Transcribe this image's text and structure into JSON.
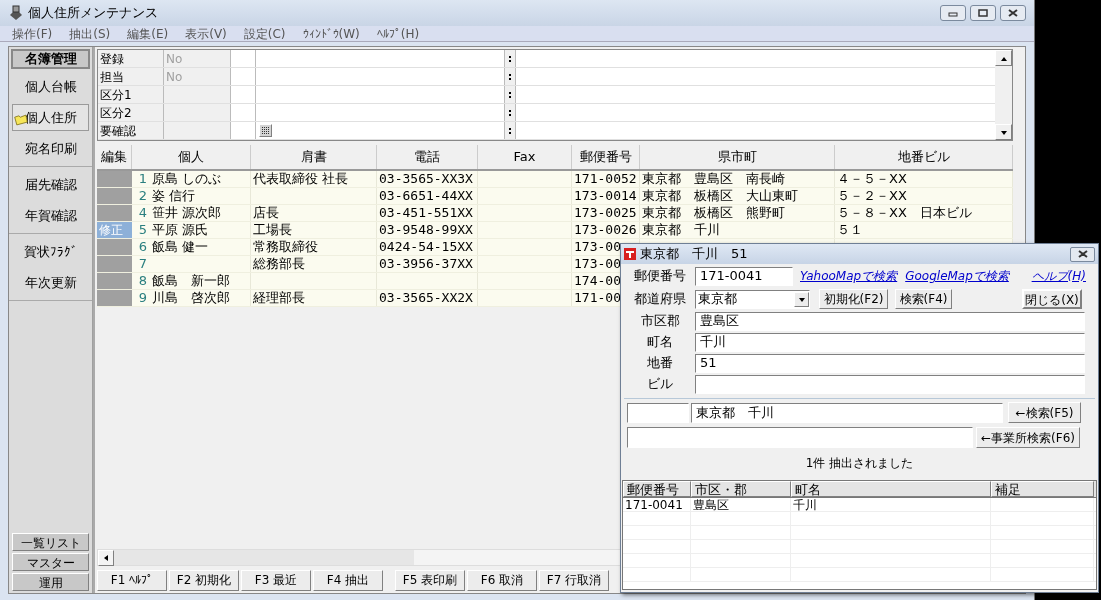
{
  "window": {
    "title": "個人住所メンテナンス"
  },
  "menu": [
    "操作(F)",
    "抽出(S)",
    "編集(E)",
    "表示(V)",
    "設定(C)",
    "ｳｨﾝﾄﾞｳ(W)",
    "ﾍﾙﾌﾟ(H)"
  ],
  "sidebar": {
    "header": "名簿管理",
    "groups": [
      [
        {
          "label": "個人台帳",
          "selected": false
        },
        {
          "label": "個人住所",
          "selected": true
        },
        {
          "label": "宛名印刷",
          "selected": false
        }
      ],
      [
        {
          "label": "届先確認",
          "selected": false
        },
        {
          "label": "年賀確認",
          "selected": false
        }
      ],
      [
        {
          "label": "賀状ﾌﾗｸﾞ",
          "selected": false
        },
        {
          "label": "年次更新",
          "selected": false
        }
      ]
    ],
    "bottom_tabs": [
      "一覧リスト",
      "マスター",
      "運用"
    ]
  },
  "top_form": [
    {
      "label": "登録",
      "value": "No",
      "disabled": true
    },
    {
      "label": "担当",
      "value": "No",
      "disabled": true
    },
    {
      "label": "区分1"
    },
    {
      "label": "区分2"
    },
    {
      "label": "要確認",
      "kind": "flag"
    }
  ],
  "table": {
    "columns": [
      "編集",
      "個人",
      "肩書",
      "電話",
      "Fax",
      "郵便番号",
      "県市町",
      "地番ビル"
    ],
    "rows": [
      {
        "edit": "",
        "number": "1",
        "name": "原島 しのぶ",
        "title": "代表取締役 社長",
        "phone": "03-3565-XX3X",
        "postal": "171-0052",
        "address": "東京都　豊島区　南長崎",
        "lot": "４－５－XX",
        "selected": false
      },
      {
        "edit": "",
        "number": "2",
        "name": "姿 信行",
        "phone": "03-6651-44XX",
        "postal": "173-0014",
        "address": "東京都　板橋区　大山東町",
        "lot": "５－２－XX",
        "selected": false
      },
      {
        "edit": "",
        "number": "4",
        "name": "笹井 源次郎",
        "title": "店長",
        "phone": "03-451-551XX",
        "postal": "173-0025",
        "address": "東京都　板橋区　熊野町",
        "lot": "５－８－XX　日本ビル",
        "selected": false
      },
      {
        "edit": "修正",
        "number": "5",
        "name": "平原 源氏",
        "title": "工場長",
        "phone": "03-9548-99XX",
        "postal": "173-0026",
        "address": "東京都　千川",
        "lot": "５１",
        "selected": true
      },
      {
        "edit": "",
        "number": "6",
        "name": "飯島 健一",
        "title": "常務取締役",
        "phone": "0424-54-15XX",
        "postal": "173-00",
        "selected": false
      },
      {
        "edit": "",
        "number": "7",
        "title": "総務部長",
        "phone": "03-3956-37XX",
        "postal": "173-00",
        "selected": false
      },
      {
        "edit": "",
        "number": "8",
        "name": "飯島　新一郎",
        "postal": "174-00",
        "selected": false
      },
      {
        "edit": "",
        "number": "9",
        "name": "川島　啓次郎",
        "title": "経理部長",
        "phone": "03-3565-XX2X",
        "postal": "171-00",
        "selected": false
      }
    ]
  },
  "function_keys": [
    "F1 ﾍﾙﾌﾟ",
    "F2 初期化",
    "F3 最近",
    "F4 抽出",
    "F5 表印刷",
    "F6 取消",
    "F7 行取消"
  ],
  "dialog": {
    "title": "東京都　千川　51",
    "postal_code": {
      "label": "郵便番号",
      "value": "171-0041"
    },
    "links": [
      "YahooMapで検索",
      "GoogleMapで検索",
      "ヘルプ(H)"
    ],
    "prefecture": {
      "label": "都道府県",
      "value": "東京都"
    },
    "buttons": [
      "初期化(F2)",
      "検索(F4)",
      "閉じる(X)"
    ],
    "fields": [
      {
        "label": "市区郡",
        "value": "豊島区"
      },
      {
        "label": "町名",
        "value": "千川"
      },
      {
        "label": "地番",
        "value": "51"
      },
      {
        "label": "ビル"
      }
    ],
    "search_text": "東京都　千川",
    "search_button": "←検索(F5)",
    "business_button": "←事業所検索(F6)",
    "status": "1件 抽出されました",
    "results": {
      "columns": [
        "郵便番号",
        "市区・郡",
        "町名",
        "補足"
      ],
      "rows": [
        [
          "171-0041",
          "豊島区",
          "千川",
          ""
        ]
      ]
    }
  }
}
